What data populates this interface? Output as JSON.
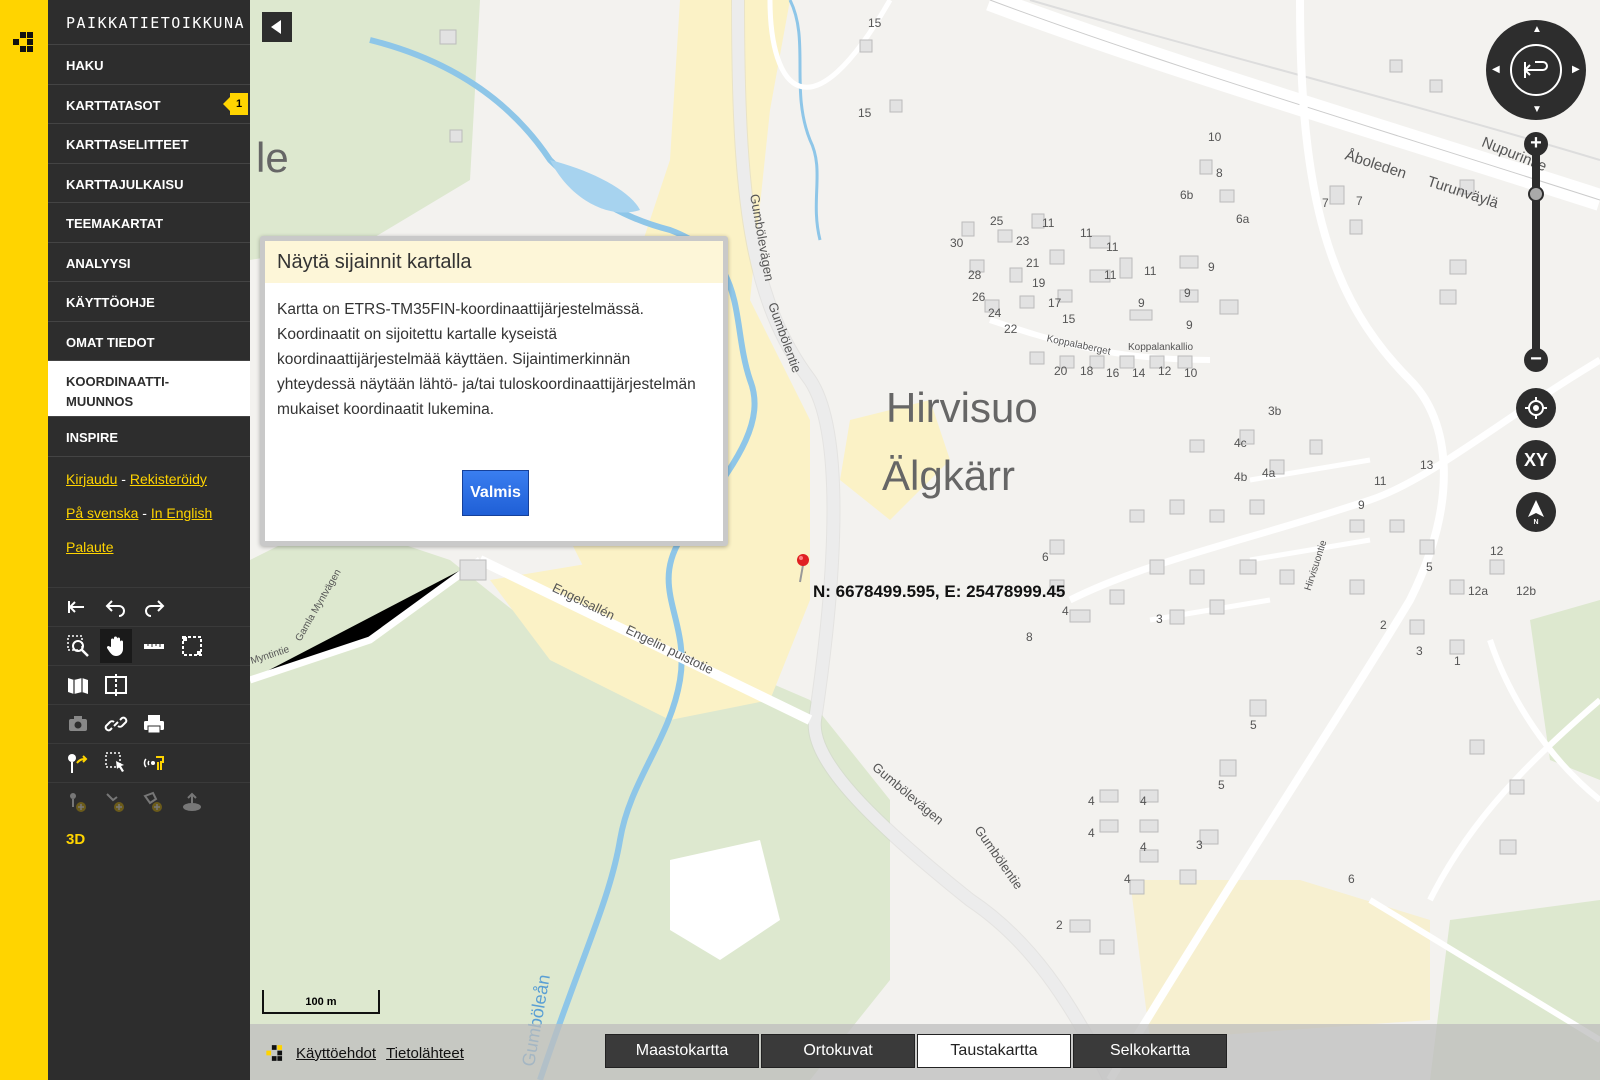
{
  "app": {
    "brand": "PAIKKATIETOIKKUNA"
  },
  "menu": [
    {
      "label": "HAKU"
    },
    {
      "label": "KARTTATASOT",
      "badge": "1"
    },
    {
      "label": "KARTTASELITTEET"
    },
    {
      "label": "KARTTAJULKAISU"
    },
    {
      "label": "TEEMAKARTAT"
    },
    {
      "label": "ANALYYSI"
    },
    {
      "label": "KÄYTTÖOHJE"
    },
    {
      "label": "OMAT TIEDOT"
    },
    {
      "label": "KOORDINAATTI-\nMUUNNOS",
      "active": true
    },
    {
      "label": "INSPIRE"
    }
  ],
  "links": {
    "login": "Kirjaudu",
    "register": "Rekisteröidy",
    "sep1": " - ",
    "swedish": "På svenska",
    "english": "In English",
    "sep2": " - ",
    "feedback": "Palaute"
  },
  "three_d": "3D",
  "popup": {
    "title": "Näytä sijainnit kartalla",
    "body": "Kartta on ETRS-TM35FIN-koordinaattijärjestelmässä. Koordinaatit on sijoitettu kartalle kyseistä koordinaattijärjestelmää käyttäen. Sijaintimerkinnän yhteydessä näytään lähtö- ja/tai tuloskoordinaattijärjestelmän mukaiset koordinaatit lukemina.",
    "button": "Valmis"
  },
  "marker_label": "N: 6678499.595, E: 25478999.45",
  "map_labels": {
    "place_fi": "Hirvisuo",
    "place_sv": "Älgkärr",
    "partial": "le",
    "streets": [
      "Gumbölevägen",
      "Gumbölentie",
      "Engelsallén",
      "Engelin puistotie",
      "Åboleden",
      "Turunväylä",
      "Nupurintie",
      "Koppalaberget",
      "Koppalankallio",
      "Hirvisuontie",
      "Gamla Myntvägen",
      "Myntintie",
      "Gumböleån"
    ],
    "numbers": [
      "15",
      "15",
      "10",
      "8",
      "6b",
      "6a",
      "7",
      "7",
      "25",
      "23",
      "30",
      "28",
      "26",
      "24",
      "22",
      "21",
      "19",
      "17",
      "15",
      "11",
      "11",
      "11",
      "11",
      "11",
      "9",
      "9",
      "9",
      "9",
      "20",
      "18",
      "16",
      "14",
      "12",
      "10",
      "3b",
      "4c",
      "4b",
      "4a",
      "13",
      "11",
      "9",
      "5",
      "3",
      "2",
      "1",
      "12",
      "12a",
      "12b",
      "4",
      "8",
      "6",
      "3",
      "5",
      "5",
      "4",
      "4",
      "4",
      "4",
      "4",
      "3",
      "2",
      "6"
    ]
  },
  "scale_label": "100 m",
  "controls": {
    "xy": "XY",
    "north": "N"
  },
  "footer": {
    "terms": "Käyttöehdot",
    "sources": "Tietolähteet"
  },
  "basemaps": [
    {
      "label": "Maastokartta"
    },
    {
      "label": "Ortokuvat"
    },
    {
      "label": "Taustakartta",
      "active": true
    },
    {
      "label": "Selkokartta"
    }
  ]
}
